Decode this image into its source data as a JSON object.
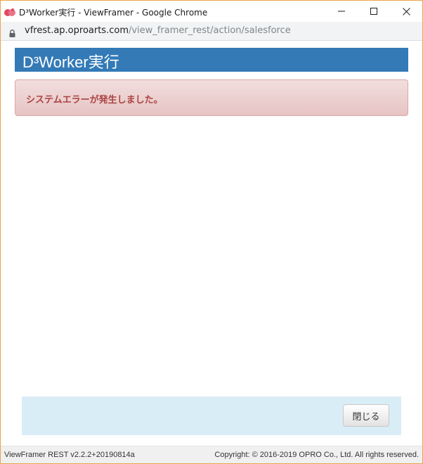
{
  "window": {
    "title": "D³Worker実行 - ViewFramer - Google Chrome",
    "app_icon": "opro-logo-icon",
    "controls": {
      "minimize_icon": "minimize-icon",
      "maximize_icon": "maximize-icon",
      "close_icon": "close-icon"
    }
  },
  "address_bar": {
    "lock_icon": "lock-icon",
    "url_host": "vfrest.ap.oproarts.com",
    "url_path": "/view_framer_rest/action/salesforce"
  },
  "page": {
    "header_title": "D³Worker実行",
    "alert_message": "システムエラーが発生しました。",
    "close_button_label": "閉じる"
  },
  "status_bar": {
    "version": "ViewFramer REST v2.2.2+20190814a",
    "copyright": "Copyright: © 2016-2019 OPRO Co., Ltd. All rights reserved."
  },
  "colors": {
    "header_bg": "#337ab7",
    "alert_bg": "#f2dede",
    "alert_text": "#a94442",
    "footer_panel_bg": "#d9edf7",
    "window_border": "#e8a64a"
  }
}
